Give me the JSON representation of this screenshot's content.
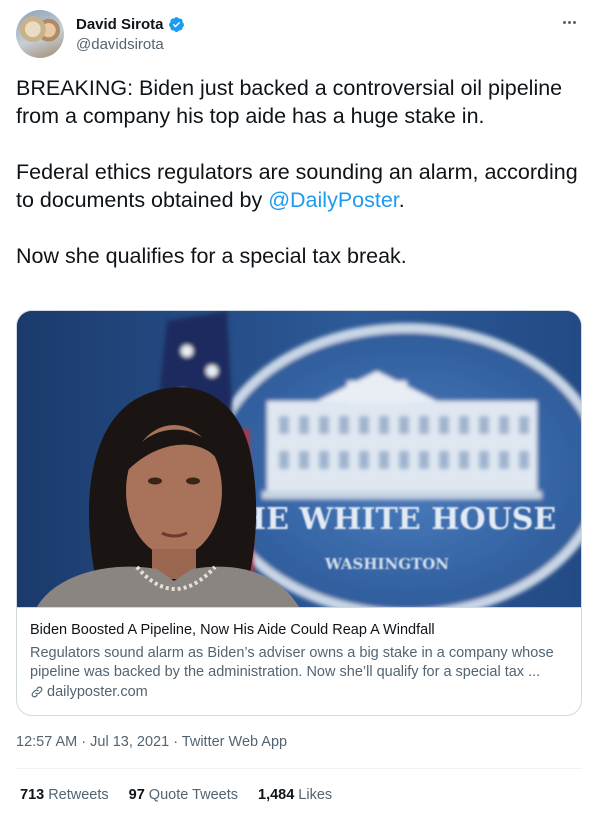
{
  "author": {
    "display_name": "David Sirota",
    "handle": "@davidsirota",
    "verified": true
  },
  "tweet": {
    "paragraph1": "BREAKING: Biden just backed a controversial oil pipeline from a company his top aide has a huge stake in.",
    "paragraph2_prefix": "Federal ethics regulators are sounding an alarm, according to documents obtained by ",
    "paragraph2_mention": "@DailyPoster",
    "paragraph2_suffix": ".",
    "paragraph3": "Now she qualifies for a special tax break."
  },
  "card": {
    "image_overlay_text_line1": "HE WHITE HOUSE",
    "image_overlay_text_line2": "WASHINGTON",
    "title": "Biden Boosted A Pipeline, Now His Aide Could Reap A Windfall",
    "description": "Regulators sound alarm as Biden’s adviser owns a big stake in a company whose pipeline was backed by the administration. Now she’ll qualify for a special tax ...",
    "domain": "dailyposter.com"
  },
  "meta": {
    "time": "12:57 AM",
    "separator": " · ",
    "date": "Jul 13, 2021",
    "source": "Twitter Web App"
  },
  "stats": {
    "retweets_count": "713",
    "retweets_label": "Retweets",
    "quotes_count": "97",
    "quotes_label": "Quote Tweets",
    "likes_count": "1,484",
    "likes_label": "Likes"
  },
  "colors": {
    "link_blue": "#1d9bf0",
    "text_primary": "#0f1419",
    "text_secondary": "#536471",
    "border": "#cfd9de"
  },
  "icons": {
    "verified": "verified-badge-icon",
    "more": "more-horizontal-icon",
    "link": "link-icon"
  }
}
